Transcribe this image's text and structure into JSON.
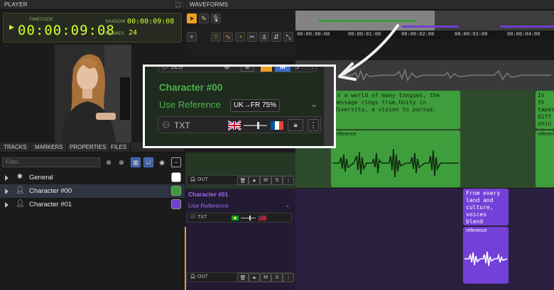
{
  "header": {
    "player_title": "PLAYER",
    "waveforms_title": "WAVEFORMS"
  },
  "timecode": {
    "label": "TIMECODE",
    "value": "00:00:09:08",
    "shadow_label": "SHADOW",
    "shadow_value": "00:00:09:08",
    "frames_label": "FRAMES",
    "frames_value": "24"
  },
  "tabs": [
    "TRACKS",
    "MARKERS",
    "PROPERTIES",
    "FILES"
  ],
  "filter": {
    "placeholder": "Filter..."
  },
  "tracks": [
    {
      "label": "General",
      "color": "#ffffff"
    },
    {
      "label": "Character #00",
      "color": "#3c9a3a"
    },
    {
      "label": "Character #01",
      "color": "#6f3fcf"
    }
  ],
  "timeline": {
    "ticks": [
      "00:00:00:00",
      "00:00:01:00",
      "00:00:02:00",
      "00:00:03:00",
      "00:00:04:00"
    ]
  },
  "track_controls": {
    "out_label": "OUT",
    "m_label": "M",
    "s_label": "S",
    "txt_label": "TXT",
    "char01_name": "Character #01",
    "use_reference": "Use Reference"
  },
  "callout": {
    "dlg_label": "DLG",
    "character_name": "Character #00",
    "use_reference": "Use Reference",
    "tooltip_text": "UK→FR 75%",
    "txt_label": "TXT",
    "m_label": "M",
    "s_label": "S"
  },
  "clips": {
    "green_text": "In a world of many tongues, the message rings true,Unity in diversity, a vision to pursue.",
    "green_text_right": "In th tapes diff shin bloo",
    "reference_label": "reference",
    "purple_text": "From every land and culture, voices blend and..."
  },
  "colors": {
    "green": "#3c9a3a",
    "purple": "#6f3fcf",
    "accent_orange": "#f0a020",
    "timecode": "#d6ff2e"
  }
}
